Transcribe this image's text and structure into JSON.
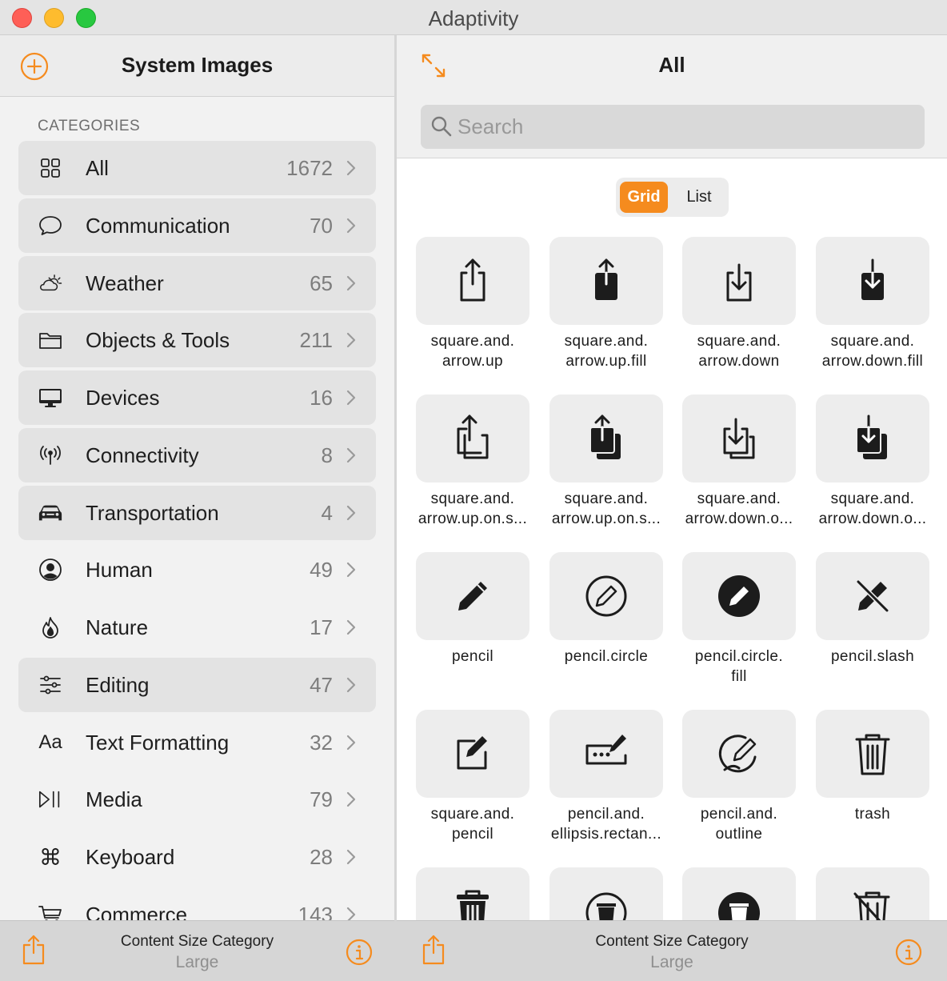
{
  "window": {
    "title": "Adaptivity"
  },
  "sidebar": {
    "title": "System Images",
    "section_label": "CATEGORIES",
    "categories": [
      {
        "label": "All",
        "count": "1672",
        "icon": "grid-icon",
        "shaded": true
      },
      {
        "label": "Communication",
        "count": "70",
        "icon": "message-bubble-icon",
        "shaded": true
      },
      {
        "label": "Weather",
        "count": "65",
        "icon": "cloud-sun-icon",
        "shaded": true
      },
      {
        "label": "Objects & Tools",
        "count": "211",
        "icon": "folder-icon",
        "shaded": true
      },
      {
        "label": "Devices",
        "count": "16",
        "icon": "desktop-icon",
        "shaded": true
      },
      {
        "label": "Connectivity",
        "count": "8",
        "icon": "antenna-icon",
        "shaded": true
      },
      {
        "label": "Transportation",
        "count": "4",
        "icon": "car-icon",
        "shaded": true
      },
      {
        "label": "Human",
        "count": "49",
        "icon": "person-circle-icon",
        "shaded": false
      },
      {
        "label": "Nature",
        "count": "17",
        "icon": "flame-icon",
        "shaded": false
      },
      {
        "label": "Editing",
        "count": "47",
        "icon": "sliders-icon",
        "shaded": true
      },
      {
        "label": "Text Formatting",
        "count": "32",
        "icon": "text-format-icon",
        "shaded": false
      },
      {
        "label": "Media",
        "count": "79",
        "icon": "play-pause-icon",
        "shaded": false
      },
      {
        "label": "Keyboard",
        "count": "28",
        "icon": "command-icon",
        "shaded": false
      },
      {
        "label": "Commerce",
        "count": "143",
        "icon": "cart-icon",
        "shaded": false
      }
    ],
    "icon_glyph_text_formatting": "Aa",
    "icon_glyph_keyboard": "⌘"
  },
  "main": {
    "title": "All",
    "search": {
      "placeholder": "Search",
      "value": ""
    },
    "segments": {
      "grid": "Grid",
      "list": "List",
      "selected": "Grid"
    },
    "symbols": [
      {
        "label": "square.and.\narrow.up",
        "icon": "square-arrow-up-icon"
      },
      {
        "label": "square.and.\narrow.up.fill",
        "icon": "square-arrow-up-fill-icon"
      },
      {
        "label": "square.and.\narrow.down",
        "icon": "square-arrow-down-icon"
      },
      {
        "label": "square.and.\narrow.down.fill",
        "icon": "square-arrow-down-fill-icon"
      },
      {
        "label": "square.and.\narrow.up.on.s...",
        "icon": "square-arrow-up-on-square-icon"
      },
      {
        "label": "square.and.\narrow.up.on.s...",
        "icon": "square-arrow-up-on-square-fill-icon"
      },
      {
        "label": "square.and.\narrow.down.o...",
        "icon": "square-arrow-down-on-square-icon"
      },
      {
        "label": "square.and.\narrow.down.o...",
        "icon": "square-arrow-down-on-square-fill-icon"
      },
      {
        "label": "pencil",
        "icon": "pencil-icon"
      },
      {
        "label": "pencil.circle",
        "icon": "pencil-circle-icon"
      },
      {
        "label": "pencil.circle.\nfill",
        "icon": "pencil-circle-fill-icon"
      },
      {
        "label": "pencil.slash",
        "icon": "pencil-slash-icon"
      },
      {
        "label": "square.and.\npencil",
        "icon": "square-and-pencil-icon"
      },
      {
        "label": "pencil.and.\nellipsis.rectan...",
        "icon": "pencil-ellipsis-rectangle-icon"
      },
      {
        "label": "pencil.and.\noutline",
        "icon": "pencil-outline-icon"
      },
      {
        "label": "trash",
        "icon": "trash-icon"
      },
      {
        "label": "",
        "icon": "trash-fill-icon"
      },
      {
        "label": "",
        "icon": "trash-circle-icon"
      },
      {
        "label": "",
        "icon": "trash-circle-fill-icon"
      },
      {
        "label": "",
        "icon": "trash-slash-icon"
      }
    ]
  },
  "footer_left": {
    "title": "Content Size Category",
    "value": "Large"
  },
  "footer_right": {
    "title": "Content Size Category",
    "value": "Large"
  },
  "colors": {
    "accent": "#f58b1e",
    "sidebar_bg": "#f2f2f2",
    "row_shade": "#e3e3e3"
  }
}
